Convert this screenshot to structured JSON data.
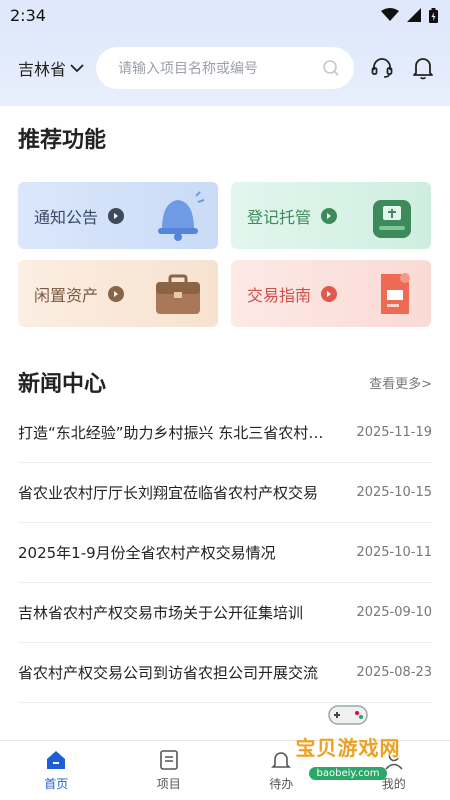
{
  "status": {
    "time": "2:34"
  },
  "header": {
    "region": "吉林省",
    "search_placeholder": "请输入项目名称或编号"
  },
  "features": {
    "title": "推荐功能",
    "items": [
      {
        "label": "通知公告",
        "icon": "bell-icon"
      },
      {
        "label": "登记托管",
        "icon": "certificate-icon"
      },
      {
        "label": "闲置资产",
        "icon": "briefcase-icon"
      },
      {
        "label": "交易指南",
        "icon": "document-icon"
      }
    ]
  },
  "news": {
    "title": "新闻中心",
    "more": "查看更多>",
    "items": [
      {
        "title": "打造“东北经验”助力乡村振兴 东北三省农村产权",
        "date": "2025-11-19"
      },
      {
        "title": "省农业农村厅厅长刘翔宜莅临省农村产权交易",
        "date": "2025-10-15"
      },
      {
        "title": "2025年1-9月份全省农村产权交易情况",
        "date": "2025-10-11"
      },
      {
        "title": "吉林省农村产权交易市场关于公开征集培训",
        "date": "2025-09-10"
      },
      {
        "title": "省农村产权交易公司到访省农担公司开展交流",
        "date": "2025-08-23"
      }
    ]
  },
  "tabs": [
    {
      "label": "首页",
      "icon": "home-icon",
      "active": true
    },
    {
      "label": "项目",
      "icon": "list-icon",
      "active": false
    },
    {
      "label": "待办",
      "icon": "bell-icon",
      "active": false
    },
    {
      "label": "我的",
      "icon": "user-icon",
      "active": false
    }
  ],
  "watermark": {
    "text": "宝贝游戏网",
    "url": "baobeiy.com"
  },
  "colors": {
    "accent": "#1e5fd6"
  }
}
